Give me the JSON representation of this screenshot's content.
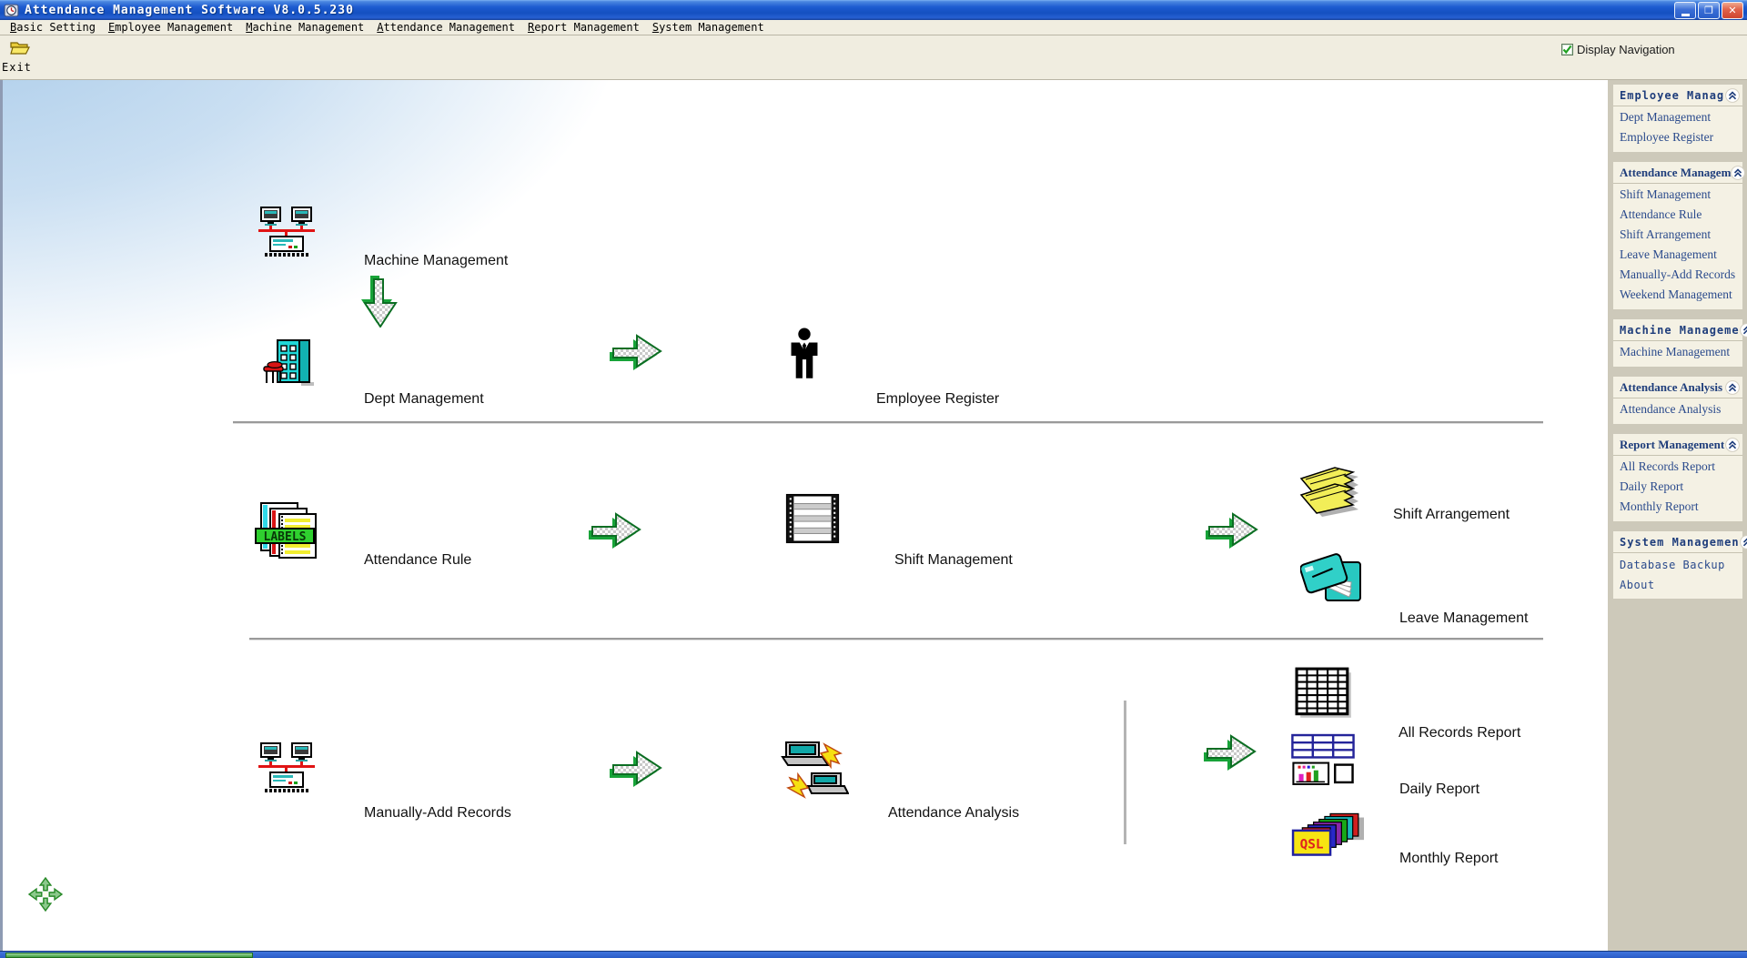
{
  "window": {
    "title": "Attendance Management Software V8.0.5.230",
    "controls": {
      "minimize_glyph": "",
      "restore_glyph": "❐",
      "close_glyph": "✕"
    }
  },
  "menu": {
    "items": [
      {
        "label": "Basic Setting"
      },
      {
        "label": "Employee Management"
      },
      {
        "label": "Machine Management"
      },
      {
        "label": "Attendance Management"
      },
      {
        "label": "Report Management"
      },
      {
        "label": "System Management"
      }
    ]
  },
  "toolbar": {
    "exit_label": "Exit",
    "display_navigation_label": "Display Navigation",
    "display_navigation_checked": "true"
  },
  "canvas": {
    "labels": {
      "machine_management": "Machine Management",
      "dept_management": "Dept Management",
      "employee_register": "Employee Register",
      "attendance_rule": "Attendance Rule",
      "shift_management": "Shift Management",
      "shift_arrangement": "Shift Arrangement",
      "leave_management": "Leave Management",
      "manually_add_records": "Manually-Add Records",
      "attendance_analysis": "Attendance Analysis",
      "all_records_report": "All Records Report",
      "daily_report": "Daily Report",
      "monthly_report": "Monthly Report"
    },
    "icon_text": {
      "labels": "LABELS",
      "qsl": "QSL"
    }
  },
  "sidebar": {
    "panels": [
      {
        "title": "Employee Manag",
        "items": [
          "Dept Management",
          "Employee Register"
        ]
      },
      {
        "title": "Attendance Managem",
        "items": [
          "Shift Management",
          "Attendance Rule",
          "Shift Arrangement",
          "Leave Management",
          "Manually-Add Records",
          "Weekend Management"
        ]
      },
      {
        "title": "Machine Manageme",
        "items": [
          "Machine Management"
        ]
      },
      {
        "title": "Attendance Analysis",
        "items": [
          "Attendance Analysis"
        ]
      },
      {
        "title": "Report Management",
        "items": [
          "All Records Report",
          "Daily Report",
          "Monthly Report"
        ]
      },
      {
        "title": "System Managemen",
        "items": [
          "Database Backup",
          "About"
        ]
      }
    ]
  },
  "colors": {
    "titlebar_blue": "#1d5bd0",
    "toolbar_bg": "#f0ede0",
    "sidebar_bg": "#cdc9ba",
    "panel_bg": "#f4f1e4",
    "navy_text": "#1e3d7b",
    "arrow_green": "#17a338",
    "network_red": "#e01414",
    "building_cyan": "#20d8d8"
  }
}
